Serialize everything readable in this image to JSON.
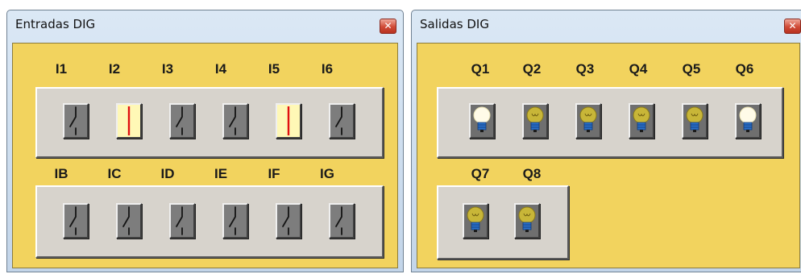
{
  "inputs_window": {
    "title": "Entradas DIG",
    "close_glyph": "✕",
    "row1": [
      {
        "label": "I1",
        "state": "off"
      },
      {
        "label": "I2",
        "state": "on"
      },
      {
        "label": "I3",
        "state": "off"
      },
      {
        "label": "I4",
        "state": "off"
      },
      {
        "label": "I5",
        "state": "on"
      },
      {
        "label": "I6",
        "state": "off"
      }
    ],
    "row2": [
      {
        "label": "IB",
        "state": "off"
      },
      {
        "label": "IC",
        "state": "off"
      },
      {
        "label": "ID",
        "state": "off"
      },
      {
        "label": "IE",
        "state": "off"
      },
      {
        "label": "IF",
        "state": "off"
      },
      {
        "label": "IG",
        "state": "off"
      }
    ]
  },
  "outputs_window": {
    "title": "Salidas DIG",
    "close_glyph": "✕",
    "row1": [
      {
        "label": "Q1",
        "state": "on"
      },
      {
        "label": "Q2",
        "state": "off"
      },
      {
        "label": "Q3",
        "state": "off"
      },
      {
        "label": "Q4",
        "state": "off"
      },
      {
        "label": "Q5",
        "state": "off"
      },
      {
        "label": "Q6",
        "state": "on"
      }
    ],
    "row2": [
      {
        "label": "Q7",
        "state": "off"
      },
      {
        "label": "Q8",
        "state": "off"
      }
    ]
  },
  "colors": {
    "client_background": "#f2d35e",
    "switch_on": "#fff8b6",
    "switch_on_line": "#e01010",
    "switch_off": "#7d7d7d",
    "bulb_on": "#fffbe8",
    "bulb_off": "#c8b638",
    "bulb_base": "#2a70c8"
  }
}
